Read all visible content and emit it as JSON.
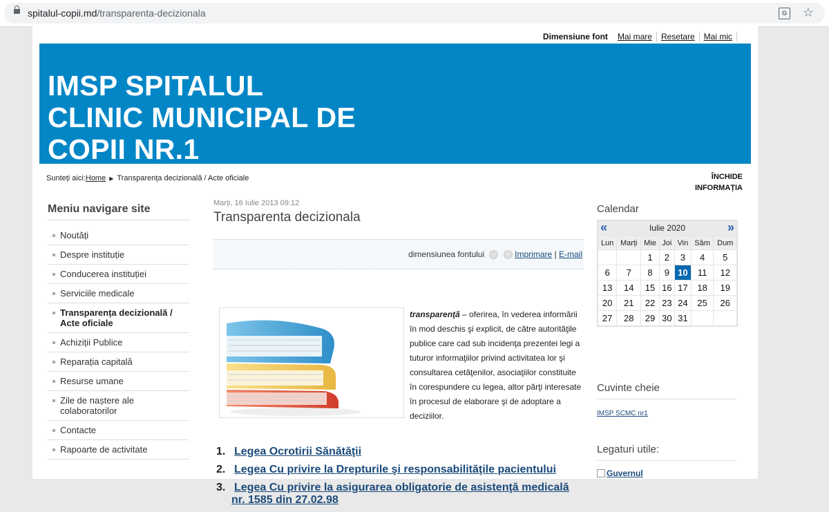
{
  "browser": {
    "url_domain": "spitalul-copii.md",
    "url_path": "/transparenta-decizionala"
  },
  "fontbar": {
    "label": "Dimensiune font",
    "bigger": "Mai mare",
    "reset": "Resetare",
    "smaller": "Mai mic"
  },
  "banner": {
    "line1": "IMSP SPITALUL",
    "line2": "CLINIC MUNICIPAL DE",
    "line3": "COPII NR.1",
    "color": "#0386c6"
  },
  "breadcrumb": {
    "prefix": "Sunteți aici:",
    "home": "Home",
    "current": "Transparența decizională / Acte oficiale"
  },
  "close_info": {
    "line1": "ÎNCHIDE",
    "line2": "INFORMAȚIA"
  },
  "menu": {
    "title": "Meniu navigare site",
    "items": [
      "Noutăți",
      "Despre instituție",
      "Conducerea instituției",
      "Serviciile medicale",
      "Transparența decizională / Acte oficiale",
      "Achiziții Publice",
      "Reparația capitală",
      "Resurse umane",
      "Zile de naștere ale colaboratorilor",
      "Contacte",
      "Rapoarte de activitate"
    ],
    "active_index": 4
  },
  "article": {
    "date": "Marți, 16 Iulie 2013 09:12",
    "title": "Transparenta decizionala",
    "toolbar_label": "dimensiunea fontului",
    "print": "Imprimare",
    "email": "E-mail",
    "term": "transparenţă",
    "text": " – oferirea, în vederea informării în mod deschis şi explicit, de către autorităţile publice care cad sub incidenţa prezentei legi a tuturor informaţiilor privind activitatea lor şi consultarea cetăţenilor, asociaţiilor constituite în corespundere cu legea, altor părţi interesate în procesul de elaborare şi de adoptare a deciziilor.",
    "laws": [
      {
        "n": "1.",
        "label": "Legea Ocrotirii Sănătăţii"
      },
      {
        "n": "2.",
        "label": "Legea Cu privire la Drepturile şi responsabilităţile pacientului"
      },
      {
        "n": "3.",
        "label": "Legea Cu privire la asigurarea obligatorie de asistenţă medicală"
      }
    ],
    "law3_cont": "nr. 1585 din 27.02.98"
  },
  "calendar": {
    "title": "Calendar",
    "month": "Iulie 2020",
    "prev": "«",
    "next": "»",
    "days": [
      "Lun",
      "Marți",
      "Mie",
      "Joi",
      "Vin",
      "Sâm",
      "Dum"
    ],
    "weeks": [
      [
        "",
        "",
        "1",
        "2",
        "3",
        "4",
        "5"
      ],
      [
        "6",
        "7",
        "8",
        "9",
        "10",
        "11",
        "12"
      ],
      [
        "13",
        "14",
        "15",
        "16",
        "17",
        "18",
        "19"
      ],
      [
        "20",
        "21",
        "22",
        "23",
        "24",
        "25",
        "26"
      ],
      [
        "27",
        "28",
        "29",
        "30",
        "31",
        "",
        ""
      ]
    ],
    "today": "10"
  },
  "keywords": {
    "title": "Cuvinte cheie",
    "items": [
      "IMSP SCMC nr1"
    ]
  },
  "links": {
    "title": "Legaturi utile:",
    "first": "Guvernul"
  }
}
